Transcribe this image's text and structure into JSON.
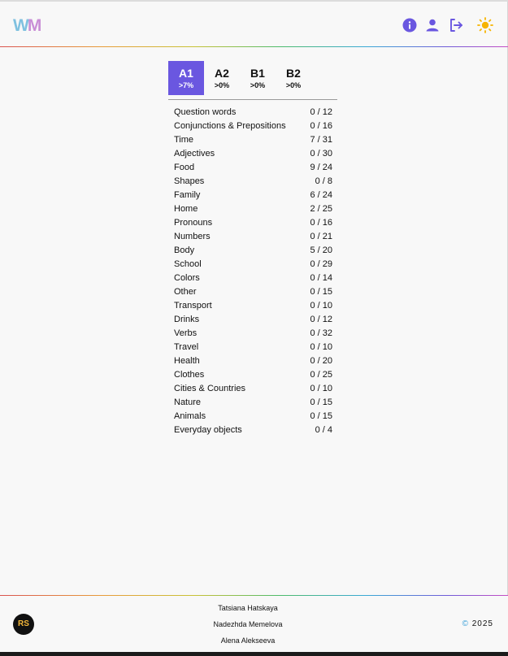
{
  "header": {
    "logo_w": "W",
    "logo_m": "M",
    "icons": [
      "info-icon",
      "user-icon",
      "logout-icon",
      "sun-icon"
    ],
    "accent_color": "#6a57e0"
  },
  "levels": [
    {
      "label": "A1",
      "progress": ">7%",
      "active": true
    },
    {
      "label": "A2",
      "progress": ">0%",
      "active": false
    },
    {
      "label": "B1",
      "progress": ">0%",
      "active": false
    },
    {
      "label": "B2",
      "progress": ">0%",
      "active": false
    }
  ],
  "topics": [
    {
      "name": "Question words",
      "count": "0 / 12"
    },
    {
      "name": "Conjunctions & Prepositions",
      "count": "0 / 16"
    },
    {
      "name": "Time",
      "count": "7 / 31"
    },
    {
      "name": "Adjectives",
      "count": "0 / 30"
    },
    {
      "name": "Food",
      "count": "9 / 24"
    },
    {
      "name": "Shapes",
      "count": "0 / 8"
    },
    {
      "name": "Family",
      "count": "6 / 24"
    },
    {
      "name": "Home",
      "count": "2 / 25"
    },
    {
      "name": "Pronouns",
      "count": "0 / 16"
    },
    {
      "name": "Numbers",
      "count": "0 / 21"
    },
    {
      "name": "Body",
      "count": "5 / 20"
    },
    {
      "name": "School",
      "count": "0 / 29"
    },
    {
      "name": "Colors",
      "count": "0 / 14"
    },
    {
      "name": "Other",
      "count": "0 / 15"
    },
    {
      "name": "Transport",
      "count": "0 / 10"
    },
    {
      "name": "Drinks",
      "count": "0 / 12"
    },
    {
      "name": "Verbs",
      "count": "0 / 32"
    },
    {
      "name": "Travel",
      "count": "0 / 10"
    },
    {
      "name": "Health",
      "count": "0 / 20"
    },
    {
      "name": "Clothes",
      "count": "0 / 25"
    },
    {
      "name": "Cities & Countries",
      "count": "0 / 10"
    },
    {
      "name": "Nature",
      "count": "0 / 15"
    },
    {
      "name": "Animals",
      "count": "0 / 15"
    },
    {
      "name": "Everyday objects",
      "count": "0 / 4"
    }
  ],
  "footer": {
    "rs_logo": "RS",
    "authors": [
      "Tatsiana Hatskaya",
      "Nadezhda Memelova",
      "Alena Alekseeva"
    ],
    "copyright_symbol": "©",
    "year": "2025"
  }
}
